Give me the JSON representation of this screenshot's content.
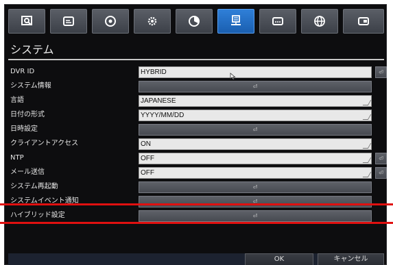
{
  "toolbar": {
    "icons": [
      {
        "name": "search-icon"
      },
      {
        "name": "record-icon"
      },
      {
        "name": "disc-icon"
      },
      {
        "name": "gear-icon"
      },
      {
        "name": "pie-chart-icon"
      },
      {
        "name": "system-icon",
        "active": true
      },
      {
        "name": "display-icon"
      },
      {
        "name": "network-icon"
      },
      {
        "name": "card-icon"
      }
    ]
  },
  "page": {
    "title": "システム"
  },
  "rows": [
    {
      "label": "DVR ID",
      "type": "text",
      "value": "HYBRID",
      "side": true
    },
    {
      "label": "システム情報",
      "type": "button"
    },
    {
      "label": "言語",
      "type": "text",
      "value": "JAPANESE"
    },
    {
      "label": "日付の形式",
      "type": "text",
      "value": "YYYY/MM/DD"
    },
    {
      "label": "日時設定",
      "type": "button"
    },
    {
      "label": "クライアントアクセス",
      "type": "text",
      "value": "ON"
    },
    {
      "label": "NTP",
      "type": "text",
      "value": "OFF",
      "side": true
    },
    {
      "label": "メール送信",
      "type": "text",
      "value": "OFF",
      "side": true
    },
    {
      "label": "システム再起動",
      "type": "button"
    },
    {
      "label": "システムイベント通知",
      "type": "button"
    },
    {
      "label": "ハイブリッド設定",
      "type": "button"
    }
  ],
  "enter_glyph": "⏎",
  "bottom": {
    "ok_label": "OK",
    "cancel_label": "キャンセル"
  },
  "colors": {
    "accent": "#2f7fd8",
    "highlight": "#e01010",
    "background": "#0d0d0f"
  }
}
